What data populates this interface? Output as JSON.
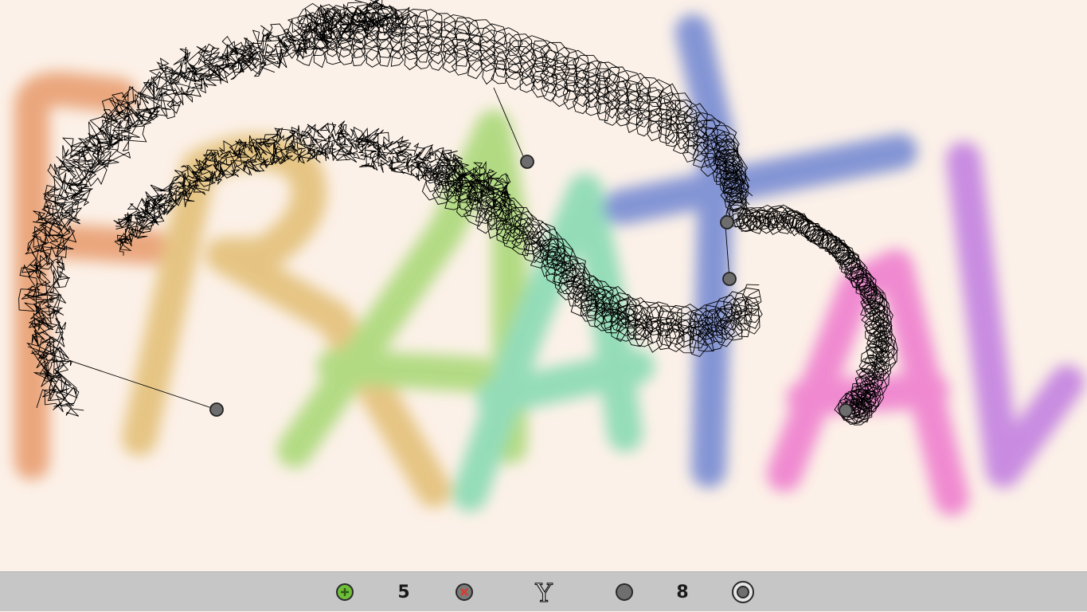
{
  "background_word": {
    "letters": [
      "F",
      "R",
      "A",
      "A",
      "F",
      "T",
      "A",
      "V"
    ],
    "letter_colors": [
      "#e79a6a",
      "#e2bd72",
      "#a6d772",
      "#82d9b0",
      "#6f85d2",
      "#6f85d2",
      "#ee78cc",
      "#c07ae0"
    ]
  },
  "fractal": {
    "stroke_color": "#000000",
    "node_color": "#6d6d6d"
  },
  "toolbar": {
    "add_point_icon": "green-plus-circle-icon",
    "point_count": "5",
    "remove_point_icon": "red-x-circle-icon",
    "middle_icon": "y-glyph-icon",
    "middle_glyph": "Y",
    "grey_point_icon": "grey-circle-icon",
    "depth_count": "8",
    "ring_icon": "ring-circle-icon",
    "colors": {
      "bar": "#c6c6c6",
      "add": "#6fbe3a",
      "remove": "#d93b2a",
      "grey": "#6f6f6f"
    }
  }
}
